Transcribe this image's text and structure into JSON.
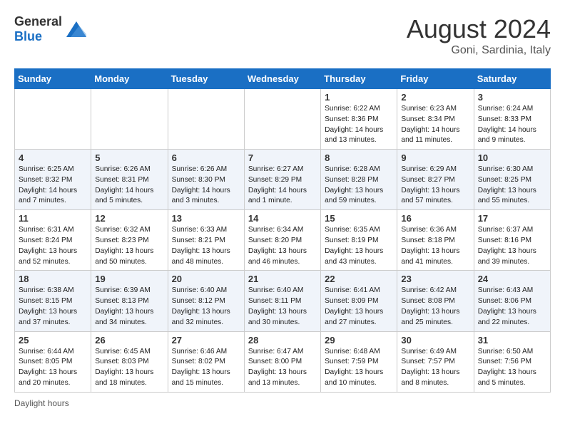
{
  "header": {
    "logo_general": "General",
    "logo_blue": "Blue",
    "month_year": "August 2024",
    "location": "Goni, Sardinia, Italy"
  },
  "weekdays": [
    "Sunday",
    "Monday",
    "Tuesday",
    "Wednesday",
    "Thursday",
    "Friday",
    "Saturday"
  ],
  "weeks": [
    [
      {
        "day": "",
        "info": ""
      },
      {
        "day": "",
        "info": ""
      },
      {
        "day": "",
        "info": ""
      },
      {
        "day": "",
        "info": ""
      },
      {
        "day": "1",
        "info": "Sunrise: 6:22 AM\nSunset: 8:36 PM\nDaylight: 14 hours\nand 13 minutes."
      },
      {
        "day": "2",
        "info": "Sunrise: 6:23 AM\nSunset: 8:34 PM\nDaylight: 14 hours\nand 11 minutes."
      },
      {
        "day": "3",
        "info": "Sunrise: 6:24 AM\nSunset: 8:33 PM\nDaylight: 14 hours\nand 9 minutes."
      }
    ],
    [
      {
        "day": "4",
        "info": "Sunrise: 6:25 AM\nSunset: 8:32 PM\nDaylight: 14 hours\nand 7 minutes."
      },
      {
        "day": "5",
        "info": "Sunrise: 6:26 AM\nSunset: 8:31 PM\nDaylight: 14 hours\nand 5 minutes."
      },
      {
        "day": "6",
        "info": "Sunrise: 6:26 AM\nSunset: 8:30 PM\nDaylight: 14 hours\nand 3 minutes."
      },
      {
        "day": "7",
        "info": "Sunrise: 6:27 AM\nSunset: 8:29 PM\nDaylight: 14 hours\nand 1 minute."
      },
      {
        "day": "8",
        "info": "Sunrise: 6:28 AM\nSunset: 8:28 PM\nDaylight: 13 hours\nand 59 minutes."
      },
      {
        "day": "9",
        "info": "Sunrise: 6:29 AM\nSunset: 8:27 PM\nDaylight: 13 hours\nand 57 minutes."
      },
      {
        "day": "10",
        "info": "Sunrise: 6:30 AM\nSunset: 8:25 PM\nDaylight: 13 hours\nand 55 minutes."
      }
    ],
    [
      {
        "day": "11",
        "info": "Sunrise: 6:31 AM\nSunset: 8:24 PM\nDaylight: 13 hours\nand 52 minutes."
      },
      {
        "day": "12",
        "info": "Sunrise: 6:32 AM\nSunset: 8:23 PM\nDaylight: 13 hours\nand 50 minutes."
      },
      {
        "day": "13",
        "info": "Sunrise: 6:33 AM\nSunset: 8:21 PM\nDaylight: 13 hours\nand 48 minutes."
      },
      {
        "day": "14",
        "info": "Sunrise: 6:34 AM\nSunset: 8:20 PM\nDaylight: 13 hours\nand 46 minutes."
      },
      {
        "day": "15",
        "info": "Sunrise: 6:35 AM\nSunset: 8:19 PM\nDaylight: 13 hours\nand 43 minutes."
      },
      {
        "day": "16",
        "info": "Sunrise: 6:36 AM\nSunset: 8:18 PM\nDaylight: 13 hours\nand 41 minutes."
      },
      {
        "day": "17",
        "info": "Sunrise: 6:37 AM\nSunset: 8:16 PM\nDaylight: 13 hours\nand 39 minutes."
      }
    ],
    [
      {
        "day": "18",
        "info": "Sunrise: 6:38 AM\nSunset: 8:15 PM\nDaylight: 13 hours\nand 37 minutes."
      },
      {
        "day": "19",
        "info": "Sunrise: 6:39 AM\nSunset: 8:13 PM\nDaylight: 13 hours\nand 34 minutes."
      },
      {
        "day": "20",
        "info": "Sunrise: 6:40 AM\nSunset: 8:12 PM\nDaylight: 13 hours\nand 32 minutes."
      },
      {
        "day": "21",
        "info": "Sunrise: 6:40 AM\nSunset: 8:11 PM\nDaylight: 13 hours\nand 30 minutes."
      },
      {
        "day": "22",
        "info": "Sunrise: 6:41 AM\nSunset: 8:09 PM\nDaylight: 13 hours\nand 27 minutes."
      },
      {
        "day": "23",
        "info": "Sunrise: 6:42 AM\nSunset: 8:08 PM\nDaylight: 13 hours\nand 25 minutes."
      },
      {
        "day": "24",
        "info": "Sunrise: 6:43 AM\nSunset: 8:06 PM\nDaylight: 13 hours\nand 22 minutes."
      }
    ],
    [
      {
        "day": "25",
        "info": "Sunrise: 6:44 AM\nSunset: 8:05 PM\nDaylight: 13 hours\nand 20 minutes."
      },
      {
        "day": "26",
        "info": "Sunrise: 6:45 AM\nSunset: 8:03 PM\nDaylight: 13 hours\nand 18 minutes."
      },
      {
        "day": "27",
        "info": "Sunrise: 6:46 AM\nSunset: 8:02 PM\nDaylight: 13 hours\nand 15 minutes."
      },
      {
        "day": "28",
        "info": "Sunrise: 6:47 AM\nSunset: 8:00 PM\nDaylight: 13 hours\nand 13 minutes."
      },
      {
        "day": "29",
        "info": "Sunrise: 6:48 AM\nSunset: 7:59 PM\nDaylight: 13 hours\nand 10 minutes."
      },
      {
        "day": "30",
        "info": "Sunrise: 6:49 AM\nSunset: 7:57 PM\nDaylight: 13 hours\nand 8 minutes."
      },
      {
        "day": "31",
        "info": "Sunrise: 6:50 AM\nSunset: 7:56 PM\nDaylight: 13 hours\nand 5 minutes."
      }
    ]
  ],
  "footer": {
    "daylight_label": "Daylight hours"
  }
}
